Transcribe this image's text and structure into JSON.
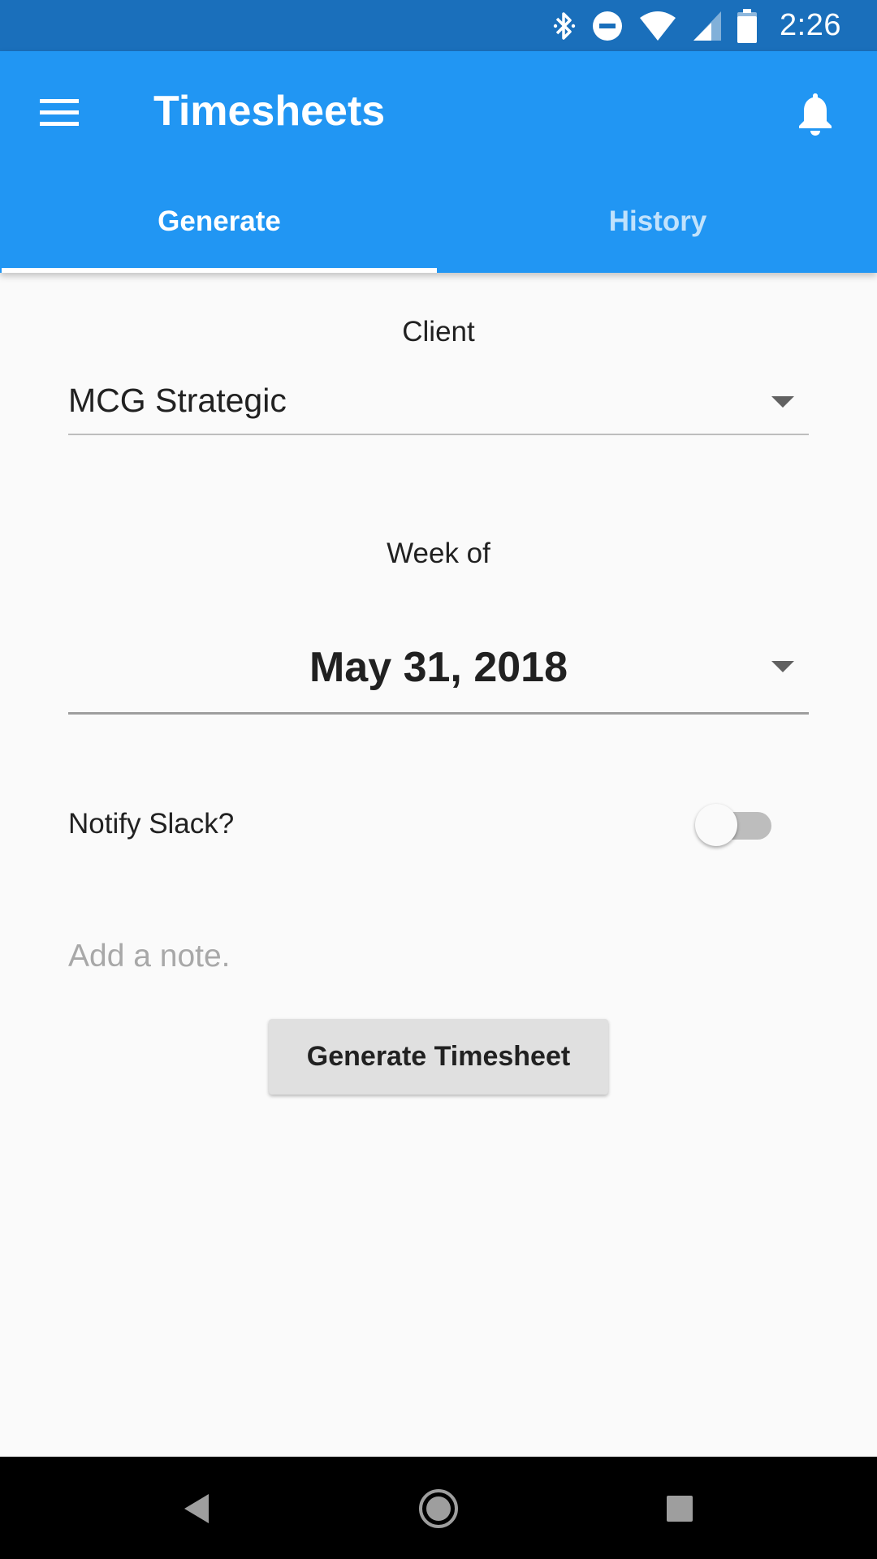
{
  "status_bar": {
    "time": "2:26",
    "icons": [
      "bluetooth-icon",
      "do-not-disturb-icon",
      "wifi-icon",
      "cell-signal-icon",
      "battery-icon"
    ]
  },
  "app_bar": {
    "title": "Timesheets",
    "color": "#2196f3",
    "status_color": "#1a6fbb",
    "menu_icon": "hamburger-menu-icon",
    "notifications_icon": "bell-icon"
  },
  "tabs": [
    {
      "label": "Generate",
      "selected": true
    },
    {
      "label": "History",
      "selected": false
    }
  ],
  "form": {
    "client_label": "Client",
    "client_value": "MCG Strategic",
    "week_label": "Week of",
    "week_value": "May 31, 2018",
    "notify_label": "Notify Slack?",
    "notify_enabled": false,
    "note_placeholder": "Add a note.",
    "note_value": "",
    "submit_label": "Generate Timesheet"
  },
  "nav_bar": {
    "icons": [
      "back-icon",
      "home-icon",
      "recents-icon"
    ]
  }
}
